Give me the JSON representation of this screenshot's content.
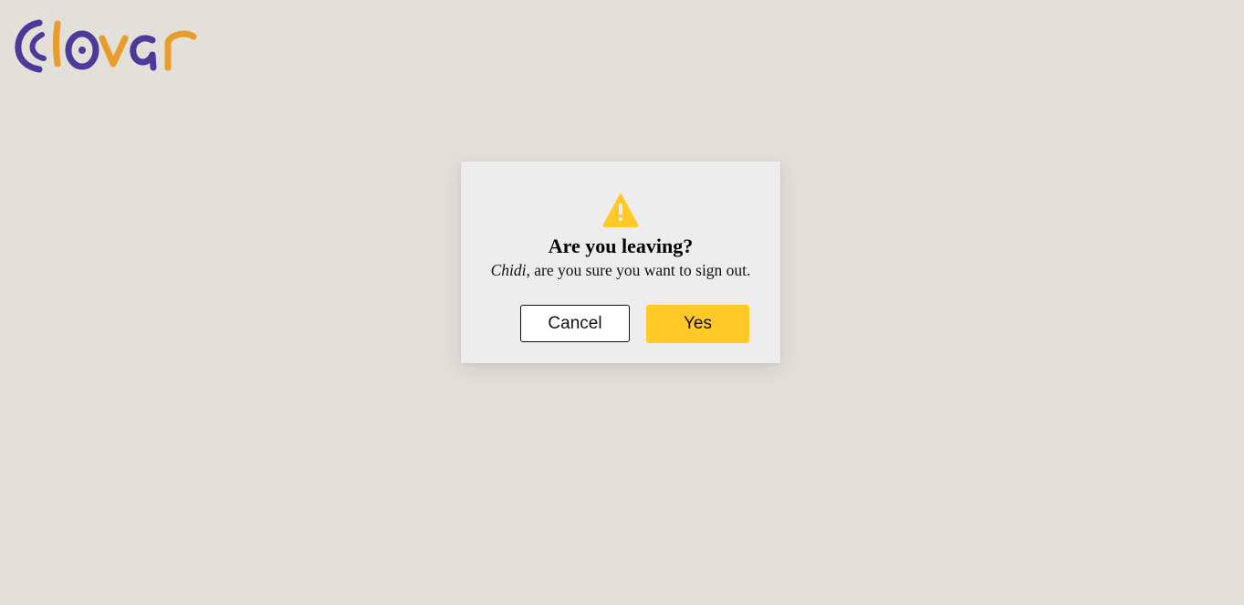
{
  "brand": {
    "name": "clovar",
    "primary_color": "#4b3a9a",
    "accent_color": "#e89c2c"
  },
  "dialog": {
    "icon": "warning-triangle-icon",
    "icon_color": "#ffc928",
    "title": "Are you leaving?",
    "user_name": "Chidi",
    "message_rest": ", are you sure you want to sign out.",
    "cancel_label": "Cancel",
    "confirm_label": "Yes",
    "confirm_color": "#ffc928"
  }
}
